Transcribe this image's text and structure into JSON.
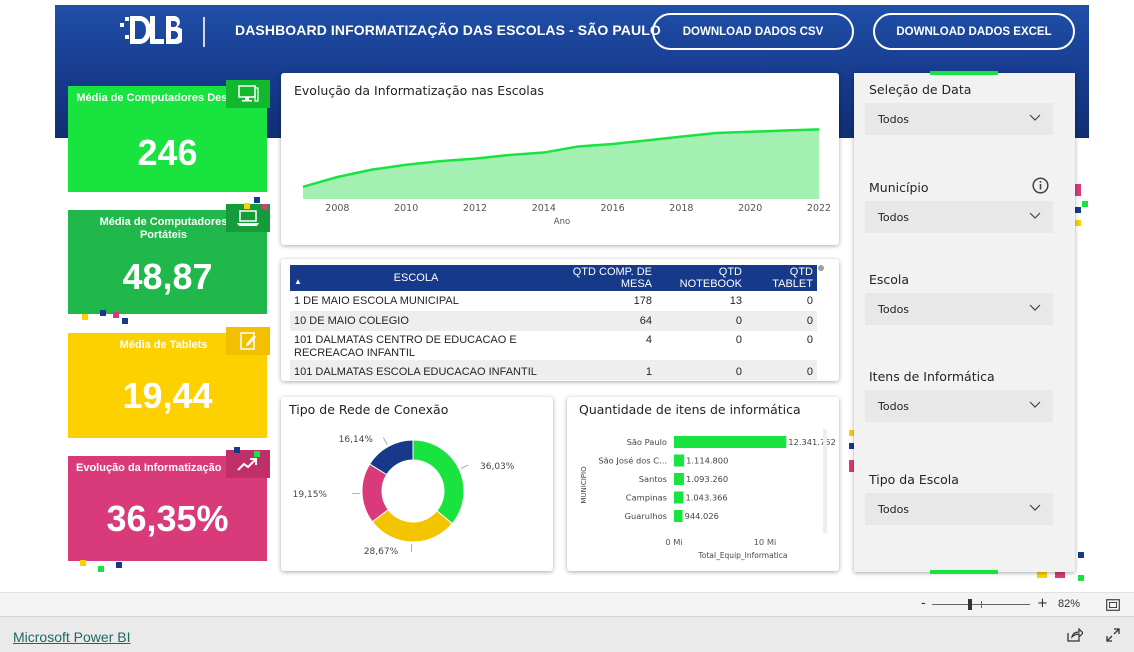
{
  "header": {
    "title": "DASHBOARD INFORMATIZAÇÃO DAS ESCOLAS - SÃO PAULO",
    "btn_csv": "DOWNLOAD DADOS CSV",
    "btn_excel": "DOWNLOAD DADOS EXCEL",
    "logo_text": "DLB"
  },
  "kpis": [
    {
      "label": "Média de Computadores Desktop",
      "value": "246",
      "icon": "desktop-icon",
      "color": "#19e33f"
    },
    {
      "label": "Média de Computadores Portáteis",
      "value": "48,87",
      "icon": "laptop-icon",
      "color": "#20b84a"
    },
    {
      "label": "Média de Tablets",
      "value": "19,44",
      "icon": "tablet-icon",
      "color": "#fdd000"
    },
    {
      "label": "Evolução da Informatização",
      "value": "36,35%",
      "icon": "trend-up-icon",
      "color": "#d93b7a"
    }
  ],
  "area_chart": {
    "title": "Evolução da Informatização nas Escolas",
    "xlabel": "Ano",
    "ticks": [
      "2008",
      "2010",
      "2012",
      "2014",
      "2016",
      "2018",
      "2020",
      "2022"
    ]
  },
  "table": {
    "headers": [
      "ESCOLA",
      "QTD COMP. DE MESA",
      "QTD NOTEBOOK",
      "QTD TABLET"
    ],
    "rows": [
      [
        "1 DE MAIO ESCOLA MUNICIPAL",
        "178",
        "13",
        "0"
      ],
      [
        "10 DE MAIO COLEGIO",
        "64",
        "0",
        "0"
      ],
      [
        "101 DALMATAS CENTRO DE EDUCACAO E RECREACAO INFANTIL",
        "4",
        "0",
        "0"
      ],
      [
        "101 DALMATAS ESCOLA EDUCACAO INFANTIL",
        "1",
        "0",
        "0"
      ]
    ]
  },
  "donut": {
    "title": "Tipo de Rede de Conexão",
    "labels": [
      "36,03%",
      "28,67%",
      "19,15%",
      "16,14%"
    ]
  },
  "bar": {
    "title": "Quantidade de itens de informática",
    "ylabel": "MUNICIPIO",
    "xlabel": "Total_Equip_Informatica",
    "xticks": [
      "0 Mi",
      "10 Mi"
    ]
  },
  "chart_data": [
    {
      "type": "area",
      "title": "Evolução da Informatização nas Escolas",
      "xlabel": "Ano",
      "ylabel": "",
      "x": [
        2007,
        2008,
        2009,
        2010,
        2011,
        2012,
        2013,
        2014,
        2015,
        2016,
        2017,
        2018,
        2019,
        2020,
        2021,
        2022
      ],
      "y": [
        10,
        18,
        24,
        28,
        31,
        33,
        36,
        38,
        43,
        45,
        48,
        51,
        54,
        55,
        56,
        57
      ],
      "xlim": [
        2007,
        2022
      ],
      "ylim": [
        0,
        72
      ],
      "color": "#19e33f"
    },
    {
      "type": "pie",
      "title": "Tipo de Rede de Conexão",
      "labels": [
        "36,03%",
        "28,67%",
        "19,15%",
        "16,14%"
      ],
      "values": [
        36.03,
        28.67,
        19.15,
        16.14
      ],
      "colors": [
        "#19e33f",
        "#f2c500",
        "#d93b7a",
        "#16398a"
      ]
    },
    {
      "type": "bar",
      "title": "Quantidade de itens de informática",
      "xlabel": "Total_Equip_Informatica",
      "ylabel": "MUNICIPIO",
      "categories": [
        "São Paulo",
        "São José dos C...",
        "Santos",
        "Campinas",
        "Guarulhos"
      ],
      "values": [
        12341752,
        1114800,
        1093260,
        1043366,
        944026
      ],
      "value_labels": [
        "12.341.752",
        "1.114.800",
        "1.093.260",
        "1.043.366",
        "944.026"
      ],
      "xlim": [
        0,
        13000000
      ],
      "color": "#19e33f"
    }
  ],
  "filters": [
    {
      "label": "Seleção de Data",
      "value": "Todos"
    },
    {
      "label": "Município",
      "value": "Todos",
      "info_icon": true
    },
    {
      "label": "Escola",
      "value": "Todos"
    },
    {
      "label": "Itens de Informática",
      "value": "Todos"
    },
    {
      "label": "Tipo da Escola",
      "value": "Todos"
    }
  ],
  "zoom": {
    "minus": "-",
    "plus": "+",
    "level": "82%"
  },
  "footer": {
    "brand": "Microsoft Power BI"
  }
}
